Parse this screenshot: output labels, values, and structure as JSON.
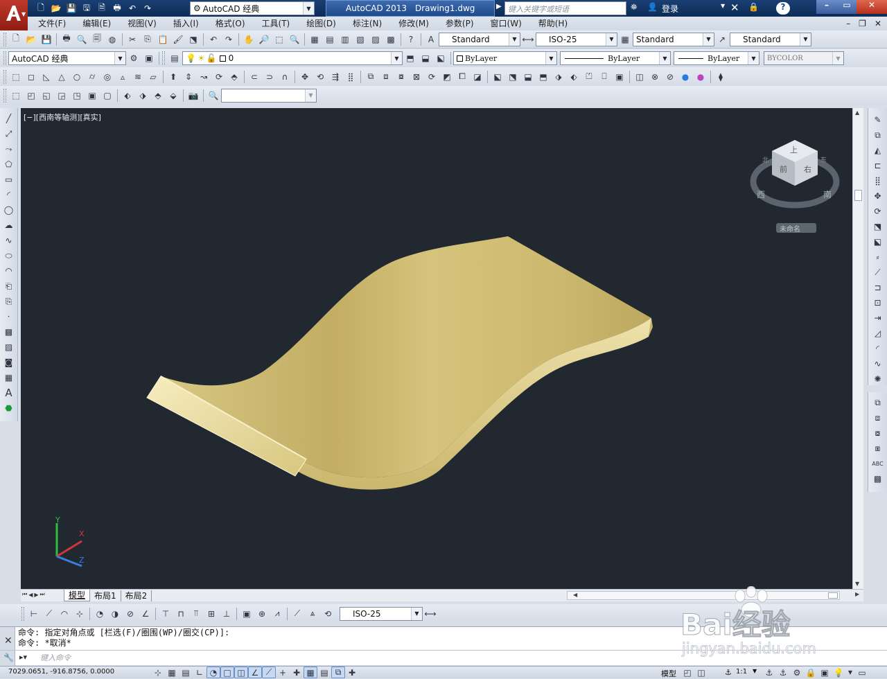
{
  "title_bar": {
    "app_name": "AutoCAD 2013",
    "file_name": "Drawing1.dwg",
    "workspace": "AutoCAD 经典",
    "search_placeholder": "键入关键字或短语",
    "login_label": "登录"
  },
  "menu": [
    "文件(F)",
    "编辑(E)",
    "视图(V)",
    "插入(I)",
    "格式(O)",
    "工具(T)",
    "绘图(D)",
    "标注(N)",
    "修改(M)",
    "参数(P)",
    "窗口(W)",
    "帮助(H)"
  ],
  "styles_toolbar": {
    "text_style": "Standard",
    "dim_style": "ISO-25",
    "table_style": "Standard",
    "mleader_style": "Standard"
  },
  "workspaces_toolbar": {
    "workspace": "AutoCAD 经典"
  },
  "layers_toolbar": {
    "current_layer": "0"
  },
  "properties_toolbar": {
    "color": "ByLayer",
    "linetype": "ByLayer",
    "lineweight": "ByLayer",
    "plotstyle": "BYCOLOR"
  },
  "viewport": {
    "label": "[−][西南等轴测][真实]",
    "background": "#212830",
    "viewcube": {
      "top": "上",
      "front": "前",
      "right": "右",
      "west": "西",
      "south": "南",
      "north": "北",
      "east": "东",
      "wcs_label": "未命名"
    },
    "ucs": {
      "x": "X",
      "y": "Y",
      "z": "Z"
    }
  },
  "layout_tabs": [
    {
      "label": "模型",
      "active": true
    },
    {
      "label": "布局1",
      "active": false
    },
    {
      "label": "布局2",
      "active": false
    }
  ],
  "dim_toolbar": {
    "dim_style": "ISO-25"
  },
  "command": {
    "history": [
      "命令: 指定对角点或 [栏选(F)/圈围(WP)/圈交(CP)]:",
      "命令: *取消*"
    ],
    "placeholder": "键入命令"
  },
  "status": {
    "coordinates": "7029.0651, -916.8756, 0.0000",
    "model_label": "模型",
    "annotation_scale": "1:1"
  },
  "watermark": {
    "text": "Bai经验",
    "url": "jingyan.baidu.com"
  },
  "colors": {
    "object": "#c9b66a",
    "accent": "#0d2c57"
  }
}
